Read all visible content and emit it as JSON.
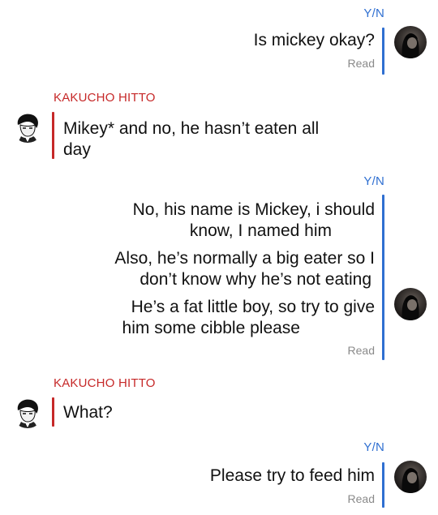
{
  "names": {
    "yn": "Y/N",
    "kakucho": "KAKUCHO HITTO"
  },
  "messages": {
    "m1": "Is mickey okay?",
    "m2_line1": "Mikey* and no, he hasn’t eaten all",
    "m2_line2": "day",
    "m3_line1": "No, his name is Mickey, i should",
    "m3_line2": "know, I named him",
    "m4_line1": "Also, he’s normally a big eater so I",
    "m4_line2": "don’t know why he’s not eating",
    "m5_line1": "He’s a fat little boy, so try to give",
    "m5_line2": "him some cibble please",
    "m6": "What?",
    "m7": "Please try to feed him"
  },
  "status": {
    "read": "Read"
  },
  "colors": {
    "yn_accent": "#2f6fd1",
    "kakucho_accent": "#c62828",
    "read_gray": "#8a8a8a"
  },
  "icons": {
    "yn_avatar": "yn-avatar-icon",
    "kakucho_avatar": "kakucho-avatar-icon"
  }
}
